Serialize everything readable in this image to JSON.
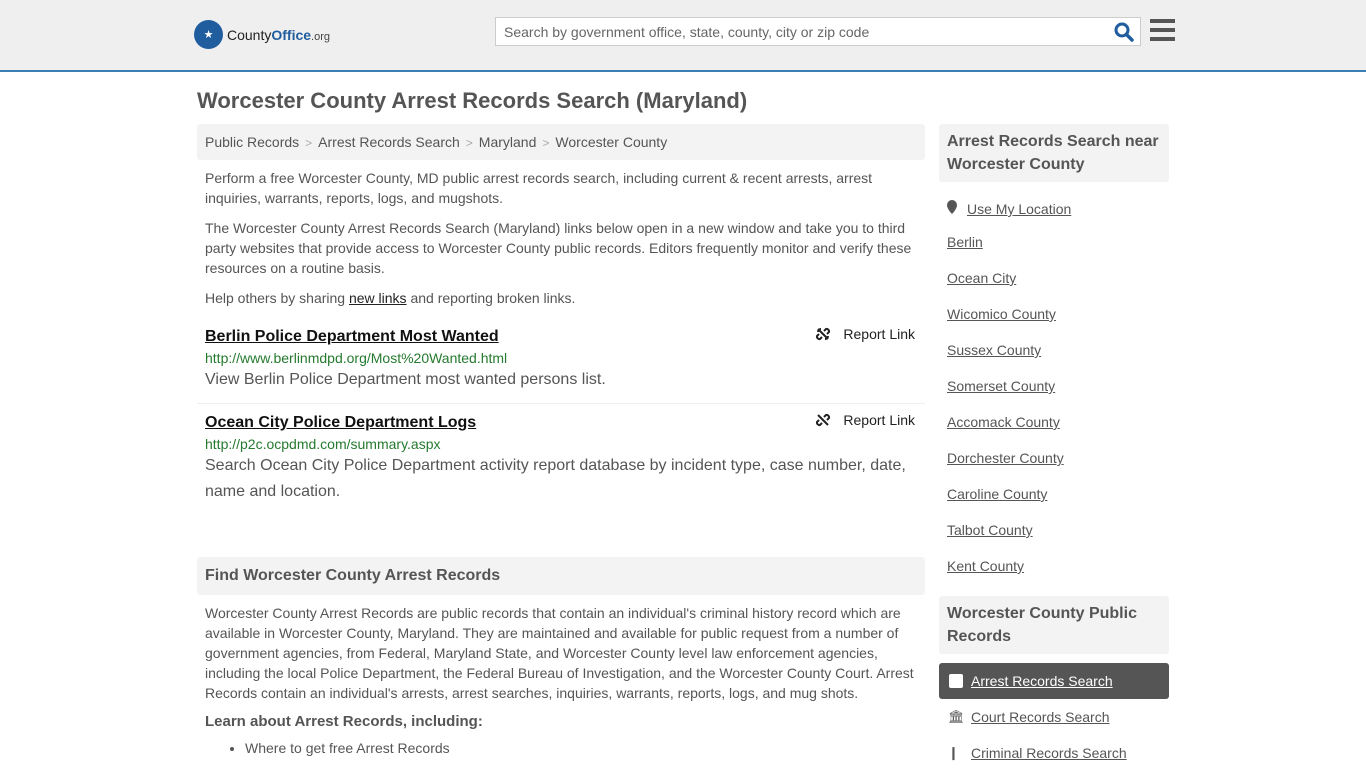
{
  "header": {
    "logo_main": "County",
    "logo_accent": "Office",
    "logo_suffix": ".org",
    "search_placeholder": "Search by government office, state, county, city or zip code"
  },
  "page_title": "Worcester County Arrest Records Search (Maryland)",
  "breadcrumb": [
    "Public Records",
    "Arrest Records Search",
    "Maryland",
    "Worcester County"
  ],
  "intro": {
    "p1": "Perform a free Worcester County, MD public arrest records search, including current & recent arrests, arrest inquiries, warrants, reports, logs, and mugshots.",
    "p2": "The Worcester County Arrest Records Search (Maryland) links below open in a new window and take you to third party websites that provide access to Worcester County public records. Editors frequently monitor and verify these resources on a routine basis.",
    "p3_pre": "Help others by sharing ",
    "p3_link": "new links",
    "p3_post": " and reporting broken links."
  },
  "report_label": "Report Link",
  "links": [
    {
      "title": "Berlin Police Department Most Wanted",
      "url": "http://www.berlinmdpd.org/Most%20Wanted.html",
      "desc": "View Berlin Police Department most wanted persons list."
    },
    {
      "title": "Ocean City Police Department Logs",
      "url": "http://p2c.ocpdmd.com/summary.aspx",
      "desc": "Search Ocean City Police Department activity report database by incident type, case number, date, name and location."
    }
  ],
  "find": {
    "heading": "Find Worcester County Arrest Records",
    "body": "Worcester County Arrest Records are public records that contain an individual's criminal history record which are available in Worcester County, Maryland. They are maintained and available for public request from a number of government agencies, from Federal, Maryland State, and Worcester County level law enforcement agencies, including the local Police Department, the Federal Bureau of Investigation, and the Worcester County Court. Arrest Records contain an individual's arrests, arrest searches, inquiries, warrants, reports, logs, and mug shots.",
    "learn": "Learn about Arrest Records, including:",
    "bullets": [
      "Where to get free Arrest Records"
    ]
  },
  "sidebar": {
    "near_heading": "Arrest Records Search near Worcester County",
    "use_location": "Use My Location",
    "nearby": [
      "Berlin",
      "Ocean City",
      "Wicomico County",
      "Sussex County",
      "Somerset County",
      "Accomack County",
      "Dorchester County",
      "Caroline County",
      "Talbot County",
      "Kent County"
    ],
    "public_heading": "Worcester County Public Records",
    "public": [
      "Arrest Records Search",
      "Court Records Search",
      "Criminal Records Search"
    ]
  }
}
